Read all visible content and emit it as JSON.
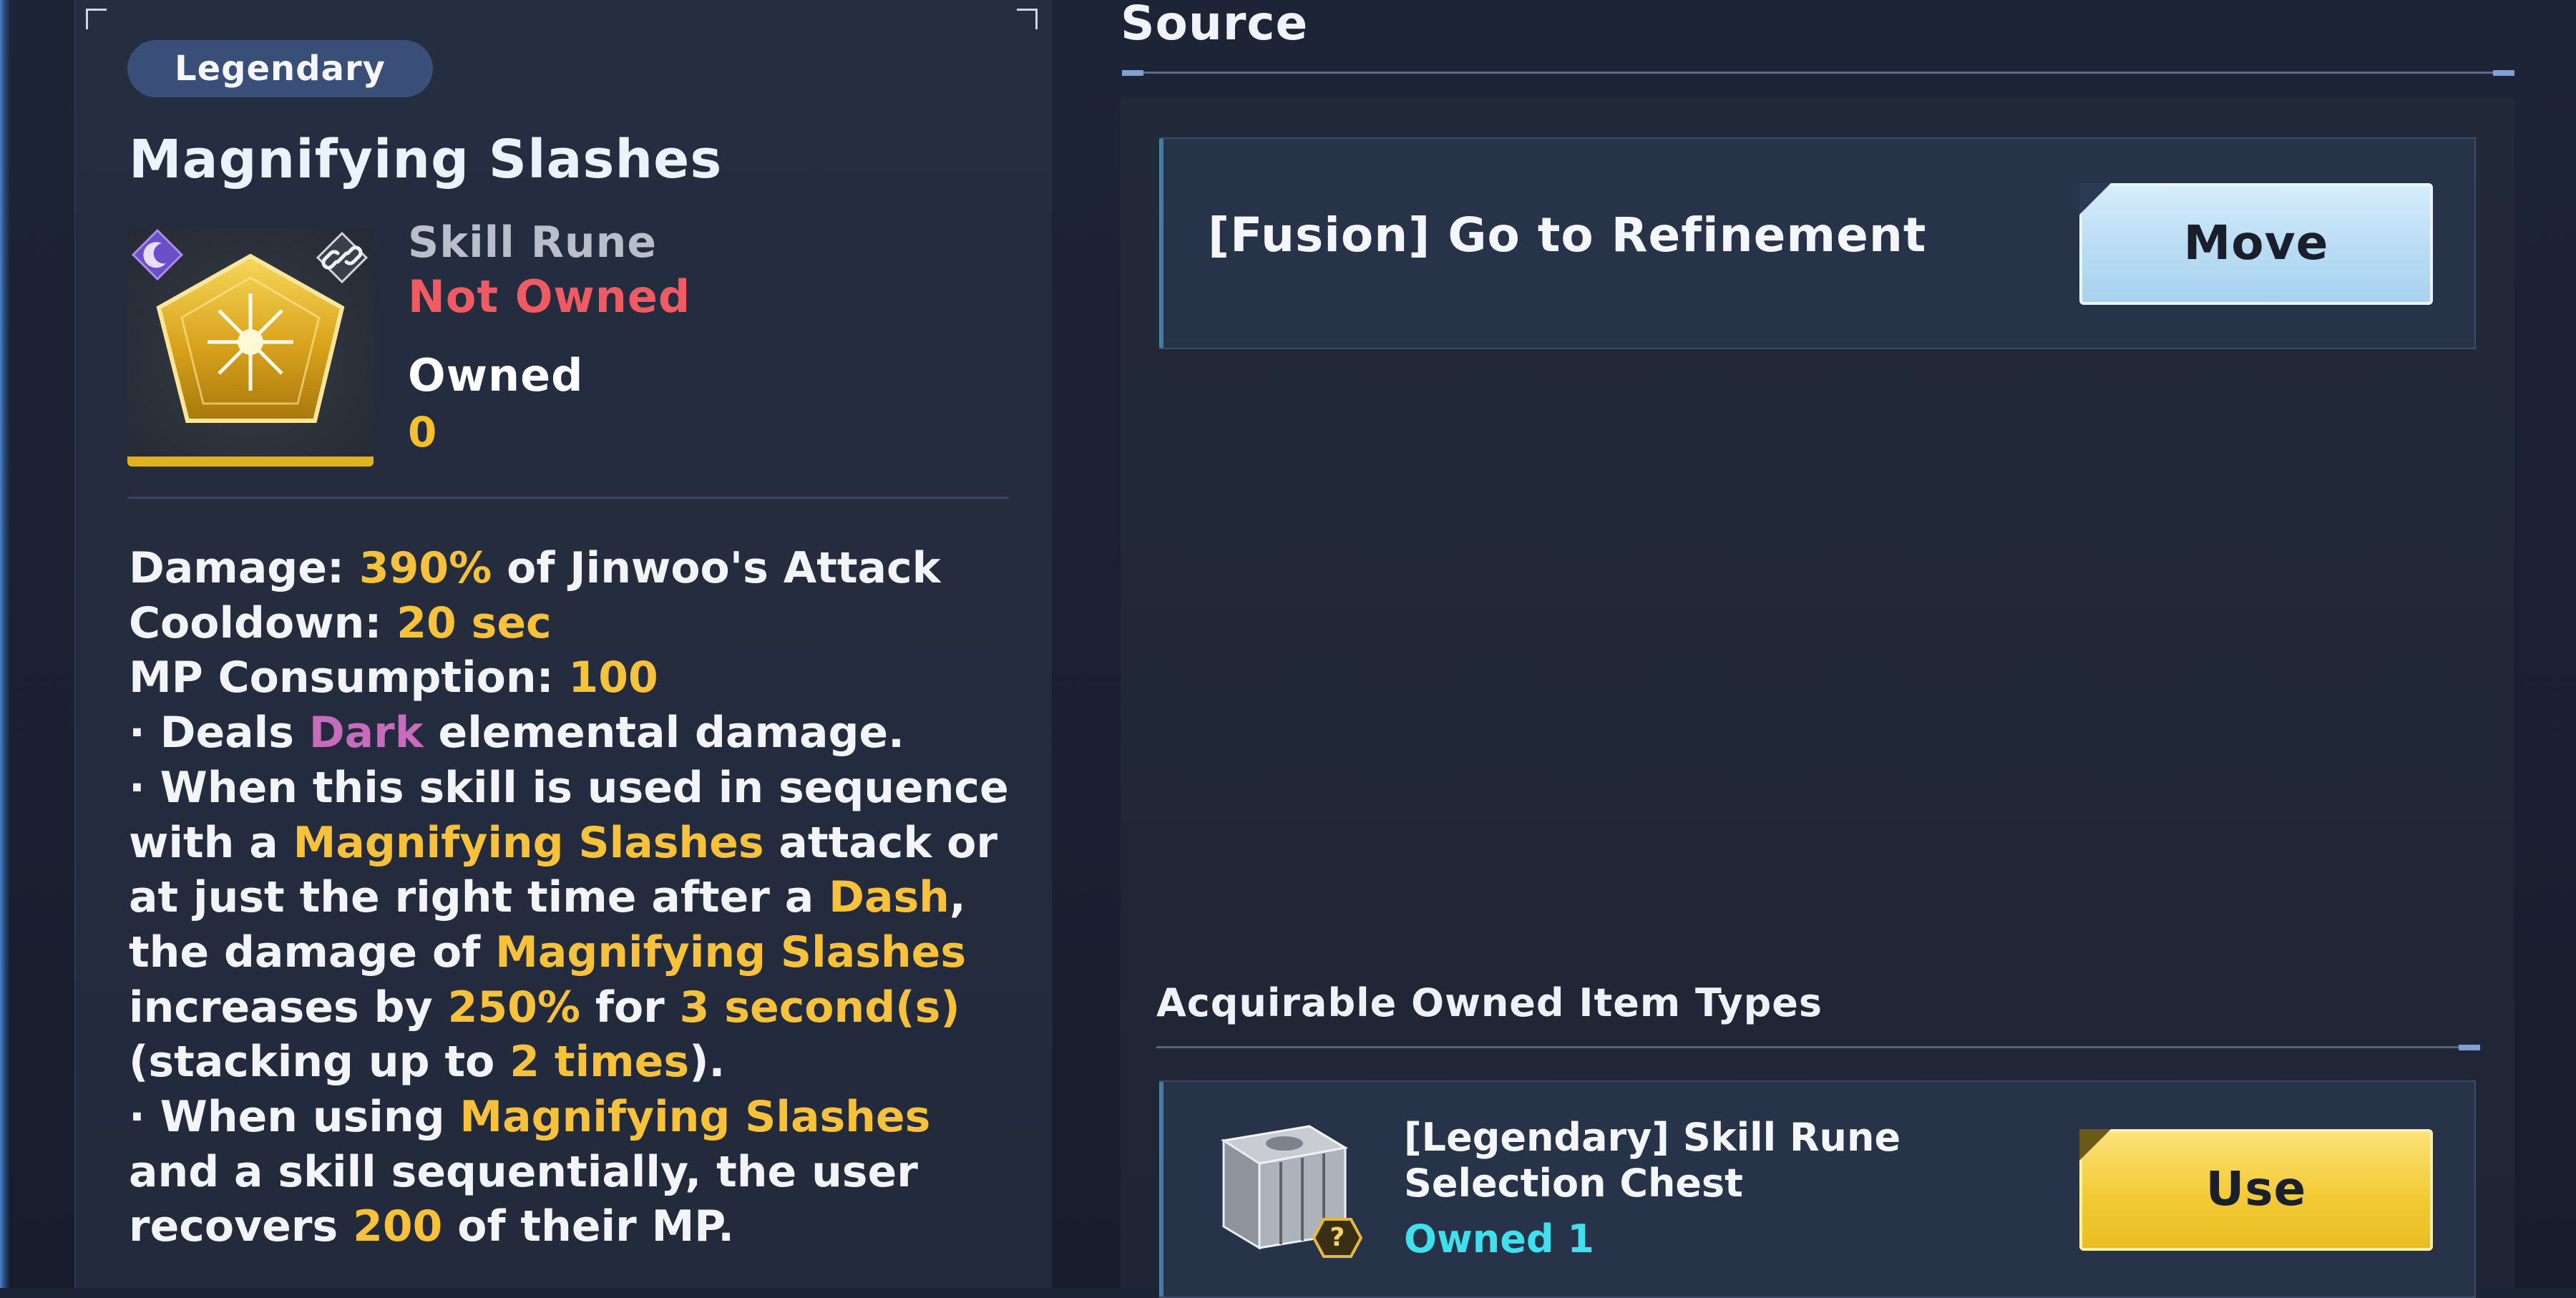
{
  "item": {
    "grade": "Legendary",
    "name": "Magnifying Slashes",
    "type": "Skill Rune",
    "owned_status": "Not Owned",
    "owned_label": "Owned",
    "owned_count": "0",
    "element_badge_icon": "crescent-moon-icon",
    "link_icon": "chain-link-icon",
    "rune_icon": "gold-pentagon-rune-icon"
  },
  "description": {
    "lines": [
      [
        {
          "t": "Damage: "
        },
        {
          "t": "390%",
          "c": "hl"
        },
        {
          "t": " of Jinwoo's Attack"
        }
      ],
      [
        {
          "t": "Cooldown: "
        },
        {
          "t": "20 sec",
          "c": "hl"
        }
      ],
      [
        {
          "t": "MP Consumption: "
        },
        {
          "t": "100",
          "c": "hl"
        }
      ],
      [
        {
          "t": "· Deals "
        },
        {
          "t": "Dark",
          "c": "dark"
        },
        {
          "t": " elemental damage."
        }
      ],
      [
        {
          "t": "· When this skill is used in sequence"
        }
      ],
      [
        {
          "t": "with a "
        },
        {
          "t": "Magnifying Slashes",
          "c": "hl"
        },
        {
          "t": " attack or"
        }
      ],
      [
        {
          "t": "at just the right time after a "
        },
        {
          "t": "Dash",
          "c": "hl"
        },
        {
          "t": ","
        }
      ],
      [
        {
          "t": "the damage of "
        },
        {
          "t": "Magnifying Slashes",
          "c": "hl"
        }
      ],
      [
        {
          "t": "increases by "
        },
        {
          "t": "250%",
          "c": "hl"
        },
        {
          "t": " for "
        },
        {
          "t": "3 second(s)",
          "c": "hl"
        }
      ],
      [
        {
          "t": "(stacking up to "
        },
        {
          "t": "2 times",
          "c": "hl"
        },
        {
          "t": ")."
        }
      ],
      [
        {
          "t": "· When using "
        },
        {
          "t": "Magnifying Slashes",
          "c": "hl"
        }
      ],
      [
        {
          "t": "and a skill sequentially, the user"
        }
      ],
      [
        {
          "t": "recovers "
        },
        {
          "t": "200",
          "c": "hl"
        },
        {
          "t": " of their MP."
        }
      ]
    ]
  },
  "source": {
    "title": "Source",
    "entries": [
      {
        "label": "[Fusion] Go to Refinement",
        "button": "Move"
      }
    ]
  },
  "acquirable": {
    "title": "Acquirable Owned Item Types",
    "items": [
      {
        "name_line1": "[Legendary] Skill Rune",
        "name_line2": "Selection Chest",
        "owned": "Owned 1",
        "button": "Use",
        "icon": "silver-chest-icon"
      }
    ]
  },
  "colors": {
    "highlight": "#f7c13a",
    "dark_element": "#c76bbd",
    "not_owned": "#ef5a63",
    "owned_count_cyan": "#3ee0ee",
    "move_button": "#b8dcf4",
    "use_button": "#f3cb36"
  }
}
